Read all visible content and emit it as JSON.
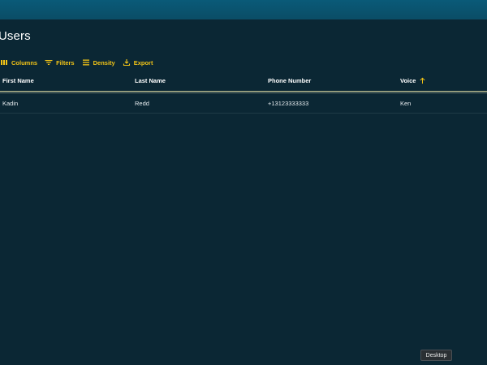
{
  "header": {
    "title": "Users"
  },
  "toolbar": {
    "columns_label": "Columns",
    "filters_label": "Filters",
    "density_label": "Density",
    "export_label": "Export",
    "accent_color": "#f2c417"
  },
  "table": {
    "columns": [
      "First Name",
      "Last Name",
      "Phone Number",
      "Voice"
    ],
    "sort": {
      "column": "Voice",
      "direction": "ascending"
    },
    "rows": [
      [
        "Kadin",
        "Redd",
        "+13123333333",
        "Ken"
      ]
    ]
  },
  "tooltip": {
    "text": "Desktop"
  }
}
